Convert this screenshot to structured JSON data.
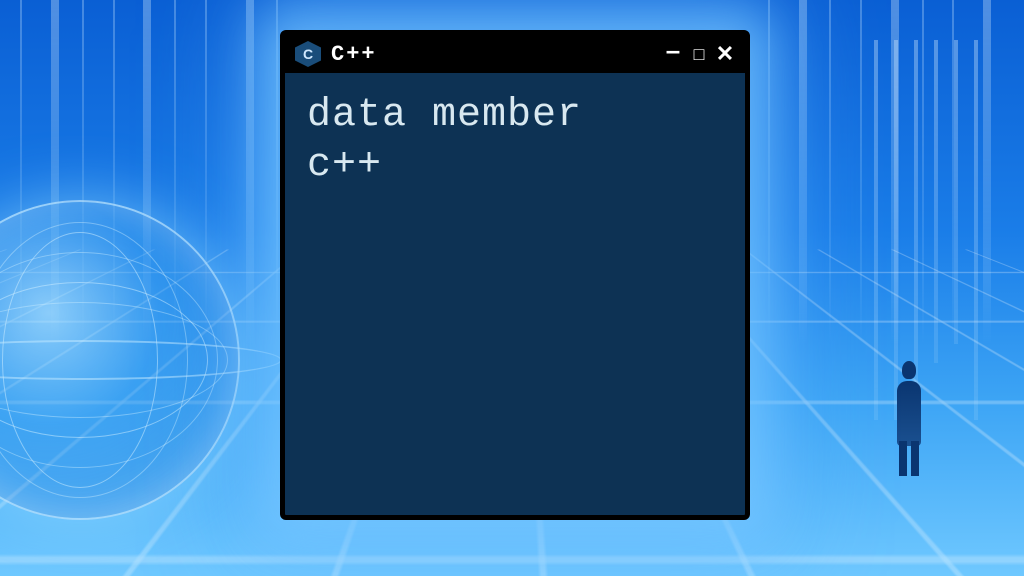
{
  "window": {
    "logo_letter": "C",
    "title": "C++",
    "controls": {
      "minimize": "–",
      "maximize": "□",
      "close": "✕"
    }
  },
  "terminal": {
    "line1": "data member",
    "line2": "c++"
  },
  "colors": {
    "terminal_bg": "#0d3254",
    "titlebar_bg": "#000000",
    "text": "#d8e8f0",
    "glow": "#78c8ff"
  }
}
